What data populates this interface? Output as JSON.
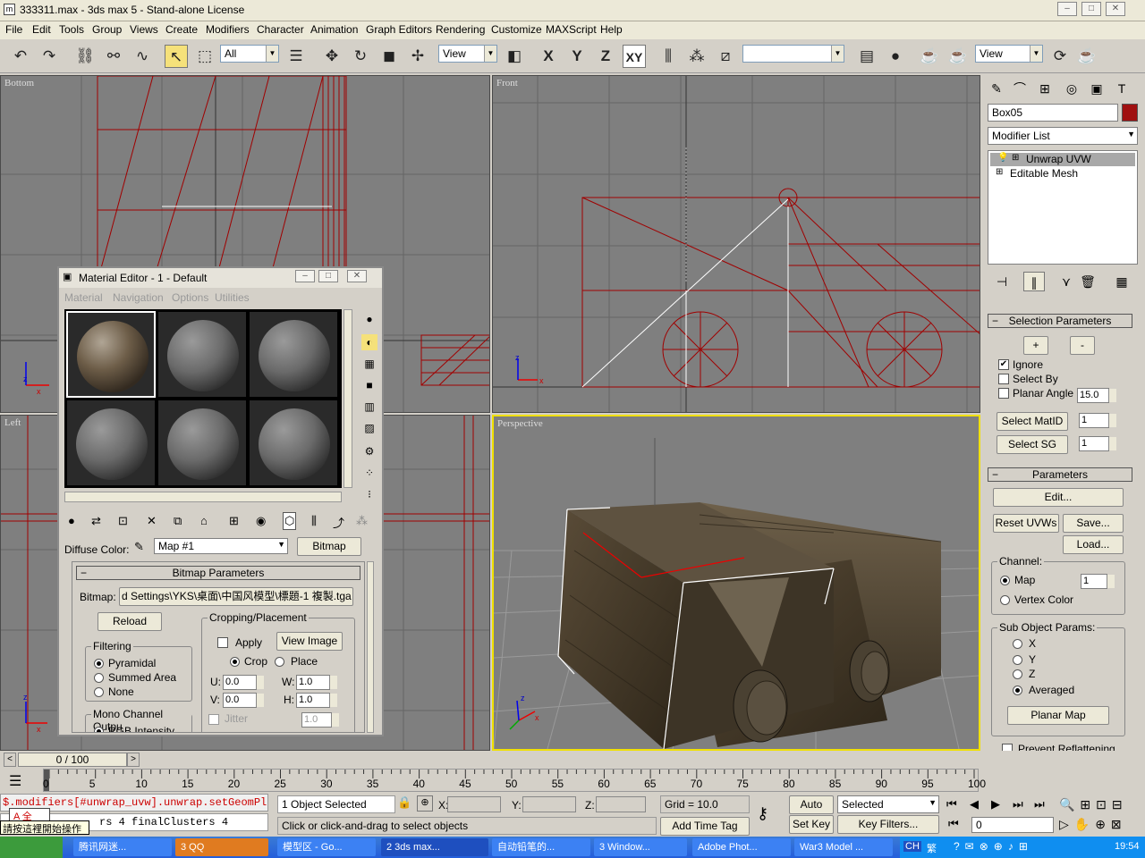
{
  "window": {
    "title": "333311.max - 3ds max 5 - Stand-alone License",
    "app_icon": "3ds-max-icon",
    "min": "‒",
    "max": "□",
    "close": "✕"
  },
  "menu": [
    "File",
    "Edit",
    "Tools",
    "Group",
    "Views",
    "Create",
    "Modifiers",
    "Character",
    "Animation",
    "Graph Editors",
    "Rendering",
    "Customize",
    "MAXScript",
    "Help"
  ],
  "toolbar": {
    "selection_filter": "All",
    "ref_coord": "View",
    "axis_x": "X",
    "axis_y": "Y",
    "axis_z": "Z",
    "axis_xy": "XY",
    "named_sel": "",
    "render_view": "View"
  },
  "viewports": {
    "bottom": "Bottom",
    "front": "Front",
    "left": "Left",
    "perspective": "Perspective"
  },
  "command_panel": {
    "object_name": "Box05",
    "object_color": "#a01010",
    "modifier_list": "Modifier List",
    "stack": [
      "Unwrap UVW",
      "Editable Mesh"
    ],
    "selection_parameters": {
      "title": "Selection Parameters",
      "plus": "+",
      "minus": "-",
      "ignore": "Ignore",
      "select_by": "Select By",
      "planar_angle": "Planar Angle",
      "planar_angle_value": "15.0",
      "select_matid": "Select MatID",
      "matid_value": "1",
      "select_sg": "Select SG",
      "sg_value": "1"
    },
    "parameters": {
      "title": "Parameters",
      "edit": "Edit...",
      "reset": "Reset UVWs",
      "save": "Save...",
      "load": "Load...",
      "channel": "Channel:",
      "map": "Map",
      "map_value": "1",
      "vertex_color": "Vertex Color",
      "sub_object": "Sub Object Params:",
      "x": "X",
      "y": "Y",
      "z": "Z",
      "averaged": "Averaged",
      "planar_map": "Planar Map",
      "prevent": "Prevent Reflattening"
    }
  },
  "material_editor": {
    "title": "Material Editor - 1 - Default",
    "menu": [
      "Material",
      "Navigation",
      "Options",
      "Utilities"
    ],
    "diffuse_label": "Diffuse Color:",
    "map_name": "Map #1",
    "map_type": "Bitmap",
    "rollout": "Bitmap Parameters",
    "bitmap_label": "Bitmap:",
    "bitmap_path": "d Settings\\YKS\\桌面\\中国风模型\\標題-1 複製.tga",
    "reload": "Reload",
    "filtering": "Filtering",
    "pyramidal": "Pyramidal",
    "summed": "Summed Area",
    "none": "None",
    "mono": "Mono Channel Outpu",
    "rgb": "RGB Intensity",
    "cropping": "Cropping/Placement",
    "apply": "Apply",
    "view_image": "View Image",
    "crop": "Crop",
    "place": "Place",
    "u_label": "U:",
    "u": "0.0",
    "v_label": "V:",
    "v": "0.0",
    "w_label": "W:",
    "w": "1.0",
    "h_label": "H:",
    "h": "1.0",
    "jitter": "Jitter",
    "jitter_value": "1.0"
  },
  "timeline": {
    "frame": "0 / 100",
    "ticks": [
      "0",
      "5",
      "10",
      "15",
      "20",
      "25",
      "30",
      "35",
      "40",
      "45",
      "50",
      "55",
      "60",
      "65",
      "70",
      "75",
      "80",
      "85",
      "90",
      "95",
      "100"
    ]
  },
  "status": {
    "script1": "$.modifiers[#unwrap_uvw].unwrap.setGeomPla",
    "script2": "rs 4 finalClusters 4",
    "ime": "請按這裡開始操作",
    "selected": "1 Object Selected",
    "x_label": "X:",
    "y_label": "Y:",
    "z_label": "Z:",
    "grid": "Grid = 10.0",
    "auto_key": "Auto Key",
    "key_mode": "Selected",
    "set_key": "Set Key",
    "key_filters": "Key Filters...",
    "frame": "0",
    "prompt": "Click or click-and-drag to select objects",
    "add_time_tag": "Add Time Tag"
  },
  "taskbar": {
    "items": [
      "腾讯网迷...",
      "3 QQ",
      "模型区 - Go...",
      "2 3ds max...",
      "自动铅笔的...",
      "3 Window...",
      "Adobe Phot...",
      "War3 Model ..."
    ],
    "tray": [
      "CH",
      "繁"
    ],
    "time": "19:54"
  }
}
